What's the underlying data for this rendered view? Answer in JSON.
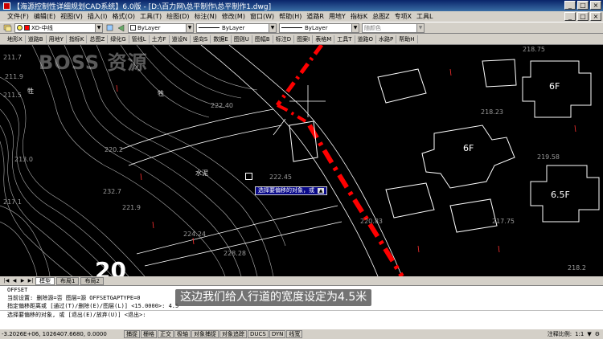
{
  "window": {
    "title": "【海源控制性详细规划CAD系统】6.0版 - [D:\\百力网\\总平制作\\总平制作1.dwg]",
    "minimize": "_",
    "maximize": "□",
    "close": "×"
  },
  "menu": {
    "items": [
      "文件(F)",
      "编辑(E)",
      "视图(V)",
      "插入(I)",
      "格式(O)",
      "工具(T)",
      "绘图(D)",
      "标注(N)",
      "修改(M)",
      "窗口(W)",
      "帮助(H)",
      "道路R",
      "用地Y",
      "指标K",
      "总图Z",
      "专项X",
      "工具L"
    ]
  },
  "toolbar": {
    "layer_combo": "XD-中线",
    "color_combo": "ByLayer",
    "linetype_combo": "ByLayer",
    "lineweight_combo": "ByLayer",
    "plotstyle_combo": "随颜色",
    "layer_color": "#ff0000"
  },
  "command_toolbar": {
    "items": [
      "地形X",
      "道路B",
      "用地Y",
      "指标K",
      "总图Z",
      "绿化G",
      "管线L",
      "土方F",
      "道设N",
      "竖向S",
      "数据E",
      "图则U",
      "图幅B",
      "标注D",
      "图案I",
      "表格M",
      "工具T",
      "道路O",
      "水路P",
      "帮助H"
    ]
  },
  "canvas": {
    "watermark": "BOSS 资源",
    "elevations": [
      "211.7",
      "211.9",
      "211.5",
      "213.0",
      "217.1",
      "222.40",
      "222.45",
      "220.2",
      "232.7",
      "221.9",
      "224.24",
      "228.28",
      "220.83",
      "218.75",
      "218.23",
      "219.58",
      "217.75",
      "218.2"
    ],
    "floor_labels": [
      "6F",
      "6F",
      "6.5F"
    ],
    "annotation_water": "水泥",
    "annotation_trees": [
      "牲",
      "牲"
    ],
    "big_number": "20",
    "tooltip_text": "选择要偏移的对象，或",
    "tooltip_arrow": "▲"
  },
  "tabs": {
    "nav": [
      "|◀",
      "◀",
      "▶",
      "▶|"
    ],
    "items": [
      "模型",
      "布局1",
      "布局2"
    ],
    "active": 0
  },
  "command": {
    "lines": [
      "OFFSET",
      "当前设置: 删除源=否  图层=源  OFFSETGAPTYPE=0",
      "指定偏移距离或 [通过(T)/删除(E)/图层(L)] <15.0000>:  4.5",
      "选择要偏移的对象, 或 [退出(E)/放弃(U)] <退出>:"
    ]
  },
  "subtitle": "这边我们给人行道的宽度设定为4.5米",
  "status": {
    "coords": "-3.2026E+06, 1026407.6680, 0.0000",
    "buttons": [
      "捕捉",
      "栅格",
      "正交",
      "极轴",
      "对象捕捉",
      "对象追踪",
      "DUCS",
      "DYN",
      "线宽"
    ],
    "scale_label": "注释比例:",
    "scale_value": "1:1"
  }
}
